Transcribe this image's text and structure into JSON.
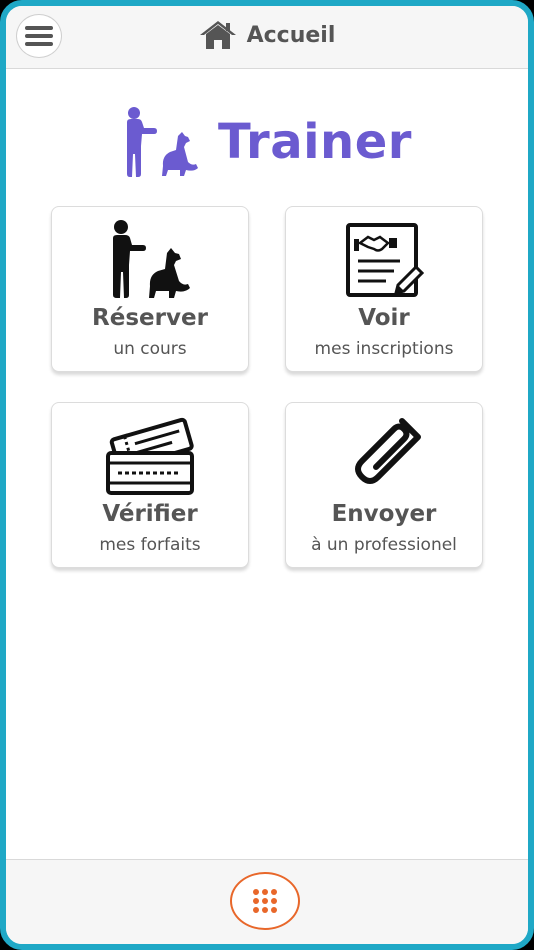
{
  "header": {
    "title": "Accueil",
    "menu_icon": "hamburger-icon",
    "title_icon": "home-icon"
  },
  "brand": {
    "name": "Trainer",
    "logo_icon": "trainer-dog-icon",
    "color": "#6b5bd0"
  },
  "cards": [
    {
      "title": "Réserver",
      "subtitle": "un cours",
      "icon": "trainer-dog-icon"
    },
    {
      "title": "Voir",
      "subtitle": "mes inscriptions",
      "icon": "contract-handshake-icon"
    },
    {
      "title": "Vérifier",
      "subtitle": "mes forfaits",
      "icon": "tickets-icon"
    },
    {
      "title": "Envoyer",
      "subtitle": "à un professionel",
      "icon": "paperclip-icon"
    }
  ],
  "footer": {
    "apps_icon": "grid-icon",
    "accent": "#e8672a"
  },
  "frame_color": "#1fa8c6"
}
